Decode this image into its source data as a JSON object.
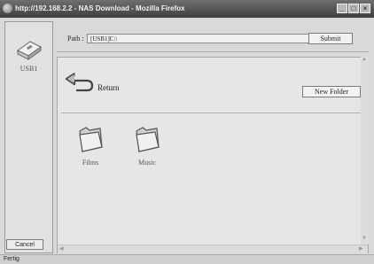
{
  "window": {
    "title": "http://192.168.2.2 - NAS Download - Mozilla Firefox",
    "controls": {
      "minimize": "_",
      "maximize": "□",
      "close": "×"
    }
  },
  "sidebar": {
    "drive_label": "USB1",
    "drive_icon": "usb-drive-icon",
    "cancel_label": "Cancel"
  },
  "pathbar": {
    "label": "Path :",
    "value": "[USB1]C:\\",
    "submit_label": "Submit"
  },
  "content": {
    "return_label": "Return",
    "return_icon": "return-arrow-icon",
    "new_folder_label": "New Folder",
    "folders": [
      {
        "label": "Films",
        "icon": "folder-icon"
      },
      {
        "label": "Music",
        "icon": "folder-icon"
      }
    ]
  },
  "scrollbars": {
    "left": "◀",
    "right": "▶",
    "up": "▲",
    "down": "▼"
  },
  "status": {
    "text": "Fertig"
  }
}
